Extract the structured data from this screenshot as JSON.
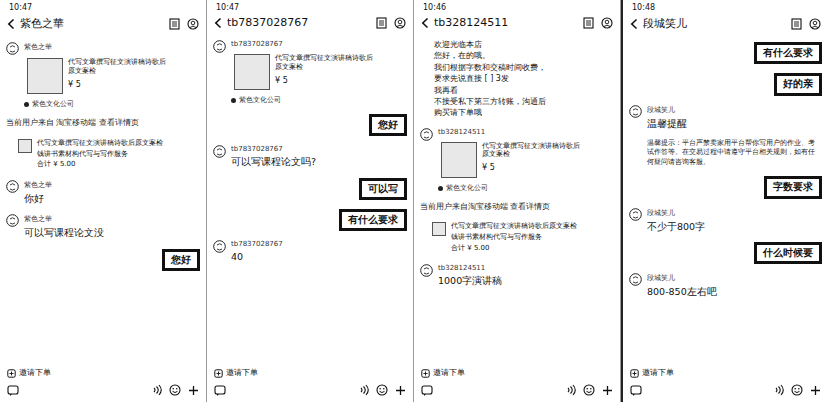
{
  "panels": [
    {
      "status_time": "10:47",
      "title": "紫色之華",
      "messages": [
        {
          "kind": "product",
          "sender": "紫色之華",
          "text": "代写文章撰写征文演讲稿诗歌后原文案检",
          "price": "¥ 5",
          "shop": "紫色文化公司"
        },
        {
          "kind": "system",
          "text": "当前用户来自 淘宝移动端 查看详情页"
        },
        {
          "kind": "order",
          "lines": [
            "代写文章撰写征文演讲稿诗歌后原文案检",
            "钱讲书素材构代写与写作服务"
          ],
          "total": "合计 ¥ 5.00"
        },
        {
          "kind": "incoming",
          "sender": "紫色之華",
          "text": "你好"
        },
        {
          "kind": "incoming",
          "sender": "紫色之華",
          "text": "可以写课程论文没"
        },
        {
          "kind": "outgoing",
          "text": "您好"
        }
      ],
      "invite": "邀请下单"
    },
    {
      "status_time": "10:47",
      "title": "tb7837028767",
      "messages": [
        {
          "kind": "product",
          "sender": "tb7837028767",
          "text": "代写文章撰写征文演讲稿诗歌后原文案检",
          "price": "¥ 5",
          "shop": "紫色文化公司"
        },
        {
          "kind": "outgoing",
          "text": "您好"
        },
        {
          "kind": "incoming",
          "sender": "tb7837028767",
          "text": "可以写课程论文吗?"
        },
        {
          "kind": "outgoing",
          "text": "可以写"
        },
        {
          "kind": "outgoing",
          "text": "有什么要求"
        },
        {
          "kind": "incoming",
          "sender": "tb7837028767",
          "text": "40"
        }
      ],
      "invite": "邀请下单"
    },
    {
      "status_time": "10:46",
      "title": "tb328124511",
      "messages": [
        {
          "kind": "welcome",
          "lines": [
            "欢迎光临本店",
            "您好，在的哦。",
            "我们根据字数和交稿时间收费，",
            "要求先说直接 [    ] 3发",
            "我再看",
            "不接受私下第三方转账，沟通后",
            "购买请下单哦"
          ]
        },
        {
          "kind": "product",
          "sender": "tb328124511",
          "text": "代写文章撰写征文演讲稿诗歌后原文案检",
          "price": "¥ 5",
          "shop": "紫色文化公司"
        },
        {
          "kind": "system",
          "text": "当前用户来自淘宝移动端 查看详情页"
        },
        {
          "kind": "order",
          "lines": [
            "代写文章撰写征文演讲稿诗歌后原文案检",
            "钱讲书素材构代写与写作服务"
          ],
          "total": "合计 ¥ 5.00"
        },
        {
          "kind": "incoming",
          "sender": "tb328124511",
          "text": "1000字演讲稿"
        }
      ],
      "invite": "邀请下单"
    },
    {
      "status_time": "10:48",
      "title": "段城笑儿",
      "messages": [
        {
          "kind": "outgoing",
          "text": "有什么要求"
        },
        {
          "kind": "outgoing",
          "text": "好的亲"
        },
        {
          "kind": "incoming",
          "sender": "段城笑儿",
          "text": "温馨提醒"
        },
        {
          "kind": "notice",
          "text": "温馨提示：平台严禁卖家用平台帮你写用户的作业、考试作答等。在交易过程中请遵守平台相关规则，如有任何疑问请咨询客服。"
        },
        {
          "kind": "outgoing",
          "text": "字数要求"
        },
        {
          "kind": "incoming",
          "sender": "段城笑儿",
          "text": "不少于800字"
        },
        {
          "kind": "outgoing",
          "text": "什么时候要"
        },
        {
          "kind": "incoming",
          "sender": "段城笑儿",
          "text": "800-850左右吧"
        }
      ],
      "invite": "邀请下单"
    }
  ]
}
